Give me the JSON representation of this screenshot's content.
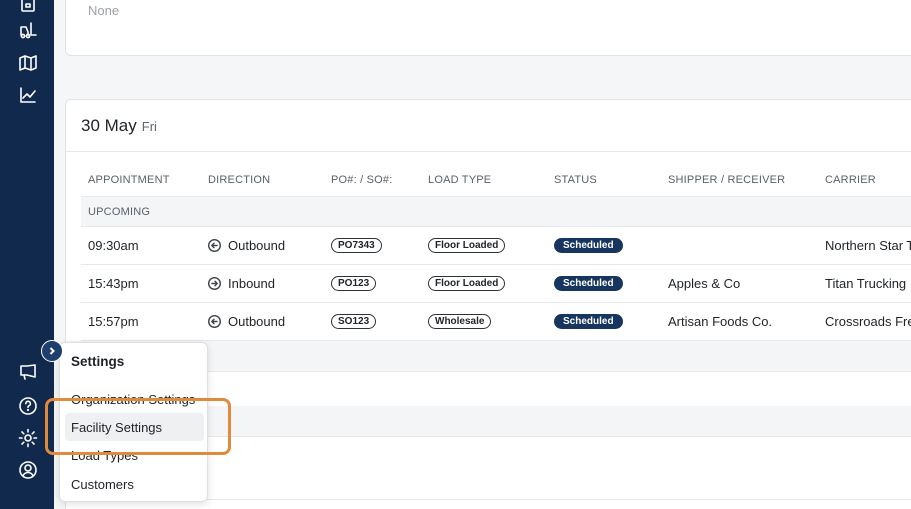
{
  "top_card": {
    "empty_text": "None"
  },
  "day": {
    "date": "30 May",
    "weekday": "Fri"
  },
  "table": {
    "headers": [
      "APPOINTMENT",
      "DIRECTION",
      "PO#: / SO#:",
      "LOAD TYPE",
      "STATUS",
      "SHIPPER / RECEIVER",
      "CARRIER"
    ],
    "group_label": "UPCOMING",
    "rows": [
      {
        "time": "09:30am",
        "direction": "Outbound",
        "po": "PO7343",
        "load_type": "Floor Loaded",
        "status": "Scheduled",
        "shipper": "",
        "carrier": "Northern Star T"
      },
      {
        "time": "15:43pm",
        "direction": "Inbound",
        "po": "PO123",
        "load_type": "Floor Loaded",
        "status": "Scheduled",
        "shipper": "Apples & Co",
        "carrier": "Titan Trucking"
      },
      {
        "time": "15:57pm",
        "direction": "Outbound",
        "po": "SO123",
        "load_type": "Wholesale",
        "status": "Scheduled",
        "shipper": "Artisan Foods Co.",
        "carrier": "Crossroads Fre"
      }
    ]
  },
  "settings_menu": {
    "title": "Settings",
    "items": [
      "Organization Settings",
      "Facility Settings",
      "Load Types",
      "Customers"
    ]
  },
  "colors": {
    "sidebar": "#10294d",
    "status_badge": "#17365f",
    "highlight": "#e08a3c"
  },
  "icons": {
    "sidebar_top": [
      "building-icon",
      "forklift-icon",
      "map-icon",
      "chart-line-icon"
    ],
    "sidebar_bottom": [
      "megaphone-icon",
      "help-icon",
      "gear-icon",
      "user-circle-icon"
    ]
  }
}
